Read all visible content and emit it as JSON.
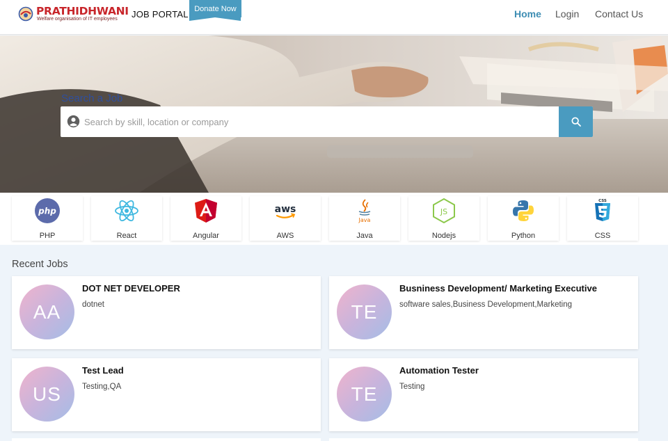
{
  "brand": {
    "name": "PRATHIDHWANI",
    "tagline": "Welfare organisation of IT employees",
    "portal_title": "JOB PORTAL"
  },
  "header": {
    "donate_label": "Donate Now",
    "nav": [
      {
        "label": "Home",
        "active": true
      },
      {
        "label": "Login",
        "active": false
      },
      {
        "label": "Contact Us",
        "active": false
      }
    ]
  },
  "search": {
    "label": "Search a Job",
    "placeholder": "Search by skill, location or company",
    "value": "",
    "person_icon": "account-circle-icon",
    "button_icon": "search-icon"
  },
  "skills": [
    {
      "label": "PHP",
      "icon": "php-icon"
    },
    {
      "label": "React",
      "icon": "react-icon"
    },
    {
      "label": "Angular",
      "icon": "angular-icon"
    },
    {
      "label": "AWS",
      "icon": "aws-icon"
    },
    {
      "label": "Java",
      "icon": "java-icon"
    },
    {
      "label": "Nodejs",
      "icon": "nodejs-icon"
    },
    {
      "label": "Python",
      "icon": "python-icon"
    },
    {
      "label": "CSS",
      "icon": "css3-icon"
    }
  ],
  "recent_jobs": {
    "title": "Recent Jobs",
    "items": [
      {
        "initials": "AA",
        "title": "DOT NET DEVELOPER",
        "skills": "dotnet"
      },
      {
        "initials": "TE",
        "title": "Busniness Development/ Marketing Executive",
        "skills": "software sales,Business Development,Marketing"
      },
      {
        "initials": "US",
        "title": "Test Lead",
        "skills": "Testing,QA"
      },
      {
        "initials": "TE",
        "title": "Automation Tester",
        "skills": "Testing"
      }
    ]
  },
  "colors": {
    "accent": "#4a9bc0",
    "brand_red": "#c8262b",
    "search_label": "#2f4f9e",
    "page_bg": "#eef4fa"
  }
}
